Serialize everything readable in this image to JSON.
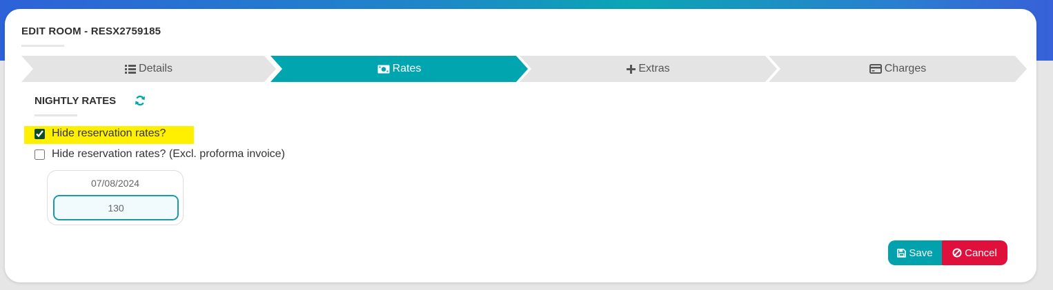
{
  "modal": {
    "title": "EDIT ROOM - RESX2759185"
  },
  "wizard": {
    "steps": [
      {
        "label": "Details",
        "icon": "list-icon",
        "active": false
      },
      {
        "label": "Rates",
        "icon": "money-bill-icon",
        "active": true
      },
      {
        "label": "Extras",
        "icon": "plus-icon",
        "active": false
      },
      {
        "label": "Charges",
        "icon": "credit-card-icon",
        "active": false
      }
    ]
  },
  "nightly_rates": {
    "title": "NIGHTLY RATES",
    "refresh_icon": "refresh-icon",
    "hide_rates_label": "Hide reservation rates?",
    "hide_rates_checked": true,
    "hide_rates_excl_label": "Hide reservation rates? (Excl. proforma invoice)",
    "hide_rates_excl_checked": false,
    "rates": [
      {
        "date": "07/08/2024",
        "value": "130"
      }
    ]
  },
  "actions": {
    "save_label": "Save",
    "cancel_label": "Cancel"
  },
  "colors": {
    "accent": "#00a5b0",
    "danger": "#e0103c",
    "highlight": "#ffef00"
  }
}
